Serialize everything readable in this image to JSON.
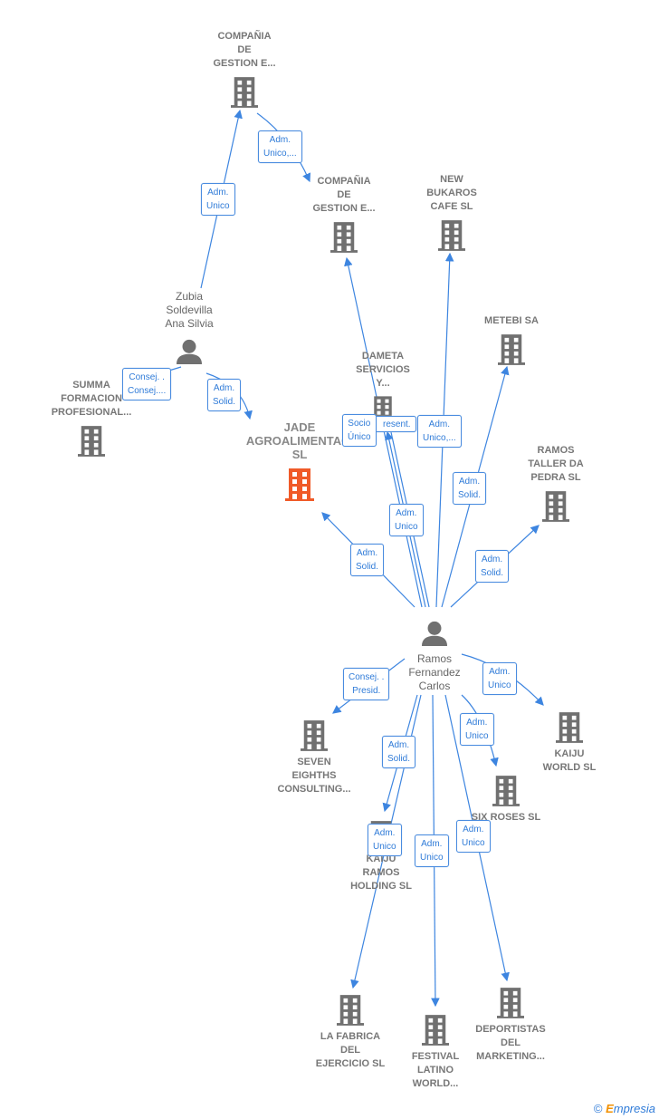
{
  "nodes": {
    "compania1": {
      "label": "COMPAÑIA\nDE\nGESTION E...",
      "type": "company"
    },
    "compania2": {
      "label": "COMPAÑIA\nDE\nGESTION E...",
      "type": "company"
    },
    "new_bukaros": {
      "label": "NEW\nBUKAROS\nCAFE SL",
      "type": "company"
    },
    "metebi": {
      "label": "METEBI SA",
      "type": "company"
    },
    "dameta": {
      "label": "DAMETA\nSERVICIOS\nY...",
      "type": "company"
    },
    "ramos_taller": {
      "label": "RAMOS\nTALLER DA\nPEDRA  SL",
      "type": "company"
    },
    "jade": {
      "label": "JADE\nAGROALIMENTACI\nSL",
      "type": "company-focus"
    },
    "zubia": {
      "label": "Zubia\nSoldevilla\nAna Silvia",
      "type": "person"
    },
    "summa": {
      "label": "SUMMA\nFORMACION\nPROFESIONAL...",
      "type": "company"
    },
    "ramos_carlos": {
      "label": "Ramos\nFernandez\nCarlos",
      "type": "person"
    },
    "seven": {
      "label": "SEVEN\nEIGHTHS\nCONSULTING...",
      "type": "company"
    },
    "kaiju_world": {
      "label": "KAIJU\nWORLD  SL",
      "type": "company"
    },
    "six_roses": {
      "label": "SIX ROSES  SL",
      "type": "company"
    },
    "kaiju_ramos": {
      "label": "KAIJU\nRAMOS\nHOLDING  SL",
      "type": "company"
    },
    "la_fabrica": {
      "label": "LA FABRICA\nDEL\nEJERCICIO  SL",
      "type": "company"
    },
    "festival": {
      "label": "FESTIVAL\nLATINO\nWORLD...",
      "type": "company"
    },
    "deportistas": {
      "label": "DEPORTISTAS\nDEL\nMARKETING...",
      "type": "company"
    }
  },
  "edges": [
    {
      "from": "zubia",
      "to": "compania1",
      "label": "Adm.\nUnico"
    },
    {
      "from": "compania1",
      "to": "compania2",
      "label": "Adm.\nUnico,..."
    },
    {
      "from": "zubia",
      "to": "jade",
      "label": "Adm.\nSolid."
    },
    {
      "from": "zubia",
      "to": "summa",
      "label": "Consej. .\nConsej...."
    },
    {
      "from": "ramos_carlos",
      "to": "jade",
      "label": "Adm.\nSolid."
    },
    {
      "from": "ramos_carlos",
      "to": "dameta",
      "label": "Adm.\nUnico"
    },
    {
      "from": "ramos_carlos",
      "to": "dameta",
      "label": "Socio\nÚnico"
    },
    {
      "from": "ramos_carlos",
      "to": "dameta",
      "label": "resent."
    },
    {
      "from": "ramos_carlos",
      "to": "new_bukaros",
      "label": "Adm.\nUnico,..."
    },
    {
      "from": "ramos_carlos",
      "to": "metebi",
      "label": "Adm.\nSolid."
    },
    {
      "from": "ramos_carlos",
      "to": "ramos_taller",
      "label": "Adm.\nSolid."
    },
    {
      "from": "ramos_carlos",
      "to": "seven",
      "label": "Consej. .\nPresid."
    },
    {
      "from": "ramos_carlos",
      "to": "kaiju_world",
      "label": "Adm.\nUnico"
    },
    {
      "from": "ramos_carlos",
      "to": "six_roses",
      "label": "Adm.\nUnico"
    },
    {
      "from": "ramos_carlos",
      "to": "kaiju_ramos",
      "label": "Adm.\nSolid."
    },
    {
      "from": "ramos_carlos",
      "to": "la_fabrica",
      "label": "Adm.\nUnico"
    },
    {
      "from": "ramos_carlos",
      "to": "festival",
      "label": "Adm.\nUnico"
    },
    {
      "from": "ramos_carlos",
      "to": "deportistas",
      "label": "Adm.\nUnico"
    }
  ],
  "colors": {
    "edge": "#3d85e0",
    "company": "#707070",
    "focus": "#f05a28",
    "person": "#707070"
  },
  "footer": {
    "copyright": "©",
    "brand_e": "E",
    "brand_rest": "mpresia"
  }
}
